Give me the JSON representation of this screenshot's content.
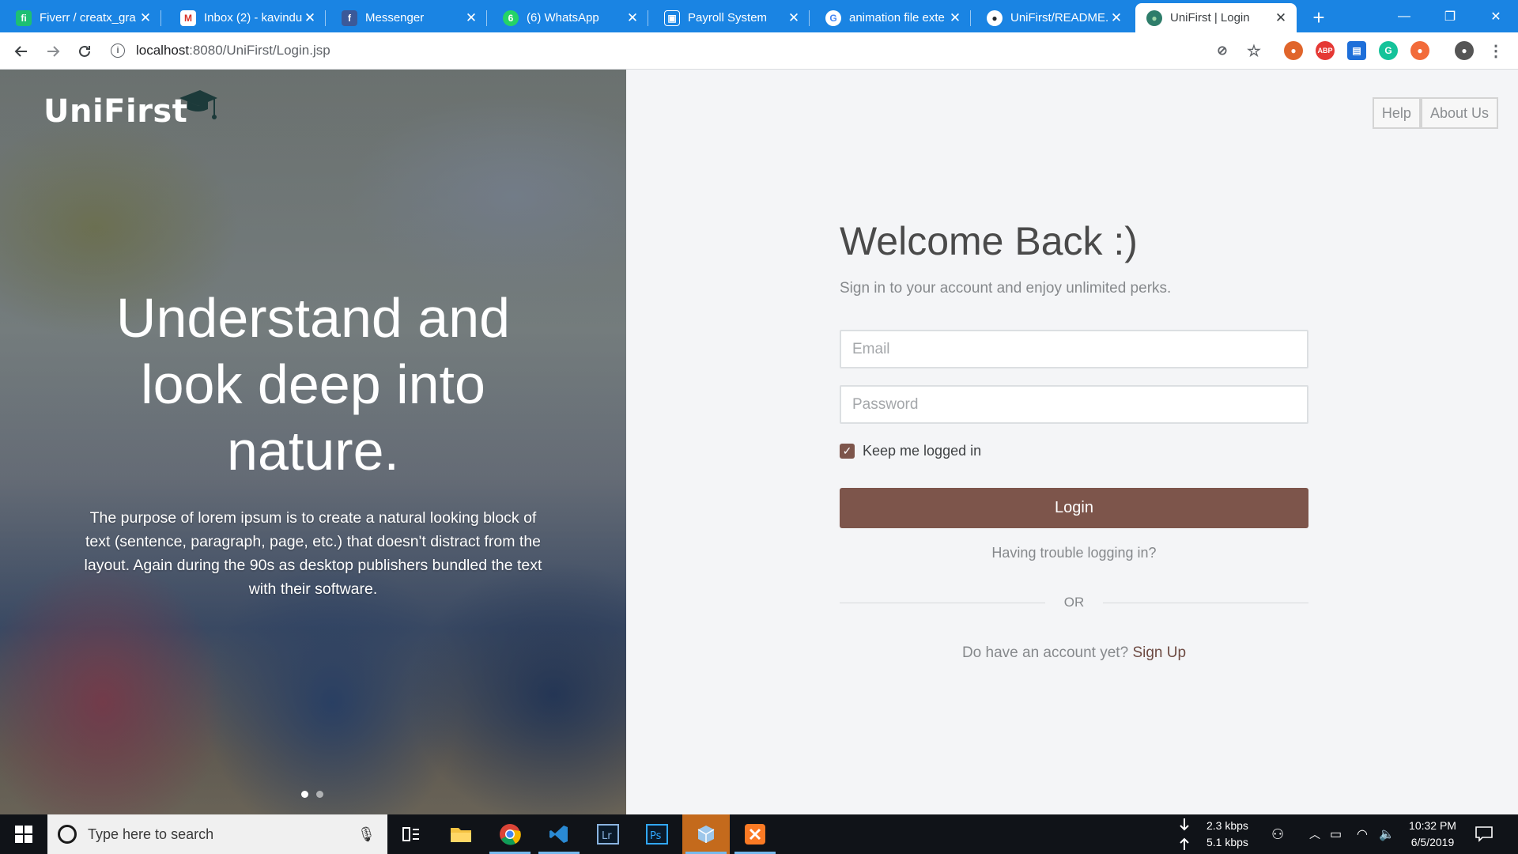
{
  "browser": {
    "tabs": [
      {
        "title": "Fiverr / creatx_gra",
        "favicon": "fiverr-icon",
        "color": "#1dbf73",
        "glyph": "fi"
      },
      {
        "title": "Inbox (2) - kavindu",
        "favicon": "gmail-icon",
        "color": "#ffffff",
        "glyph": "M"
      },
      {
        "title": "Messenger",
        "favicon": "facebook-icon",
        "color": "#3b5998",
        "glyph": "f"
      },
      {
        "title": "(6) WhatsApp",
        "favicon": "whatsapp-icon",
        "color": "#25d366",
        "glyph": "6"
      },
      {
        "title": "Payroll System",
        "favicon": "payroll-icon",
        "color": "#1a84e3",
        "glyph": "▣"
      },
      {
        "title": "animation file exte",
        "favicon": "google-icon",
        "color": "#ffffff",
        "glyph": "G"
      },
      {
        "title": "UniFirst/README.r",
        "favicon": "github-icon",
        "color": "#ffffff",
        "glyph": "●"
      },
      {
        "title": "UniFirst | Login",
        "favicon": "globe-icon",
        "color": "#2e7d6a",
        "glyph": "●"
      }
    ],
    "active_tab": 7,
    "url_host": "localhost",
    "url_rest": ":8080/UniFirst/Login.jsp"
  },
  "hero": {
    "logo": "UniFirst",
    "title": "Understand and look deep into nature.",
    "text": "The purpose of lorem ipsum is to create a natural looking block of text (sentence, paragraph, page, etc.) that doesn't distract from the layout. Again during the 90s as desktop publishers bundled the text with their software.",
    "slides": 2,
    "active_slide": 0
  },
  "topnav": {
    "help": "Help",
    "about": "About Us"
  },
  "login": {
    "heading": "Welcome Back :)",
    "subheading": "Sign in to your account and enjoy unlimited perks.",
    "email_placeholder": "Email",
    "password_placeholder": "Password",
    "keep_logged_in": "Keep me logged in",
    "keep_checked": true,
    "button": "Login",
    "trouble": "Having trouble logging in?",
    "or": "OR",
    "signup_prompt": "Do have an account yet?",
    "signup_link": "Sign Up"
  },
  "colors": {
    "accent": "#7d554b",
    "tabstrip": "#1a84e3",
    "taskbar": "#101318"
  },
  "taskbar": {
    "search_placeholder": "Type here to search",
    "net_down": "2.3 kbps",
    "net_up": "5.1 kbps",
    "time": "10:32 PM",
    "date": "6/5/2019"
  }
}
